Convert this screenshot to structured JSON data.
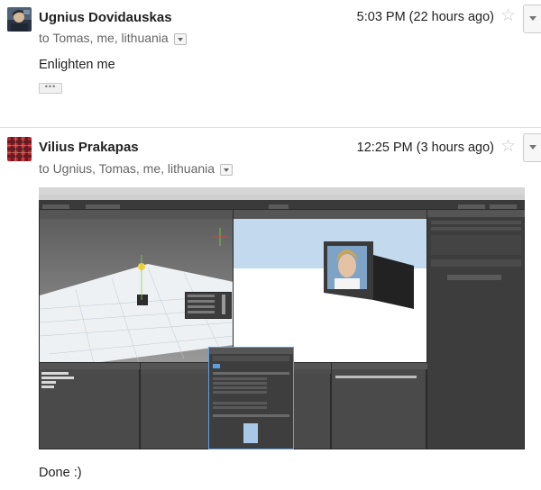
{
  "message1": {
    "sender": "Ugnius Dovidauskas",
    "recipients": "to Tomas, me, lithuania",
    "time": "5:03 PM (22 hours ago)",
    "body": "Enlighten me",
    "ellipsis": "•••"
  },
  "message2": {
    "sender": "Vilius Prakapas",
    "recipients": "to Ugnius, Tomas, me, lithuania",
    "time": "12:25 PM (3 hours ago)",
    "body": "Done :)"
  },
  "icons": {
    "star": "☆"
  },
  "colors": {
    "avatar1": "#3b4d63",
    "avatar2_plaid": "#b8222c",
    "unity_bg": "#393939",
    "sky": "#c3d9ee",
    "selection": "#5d9de0"
  }
}
